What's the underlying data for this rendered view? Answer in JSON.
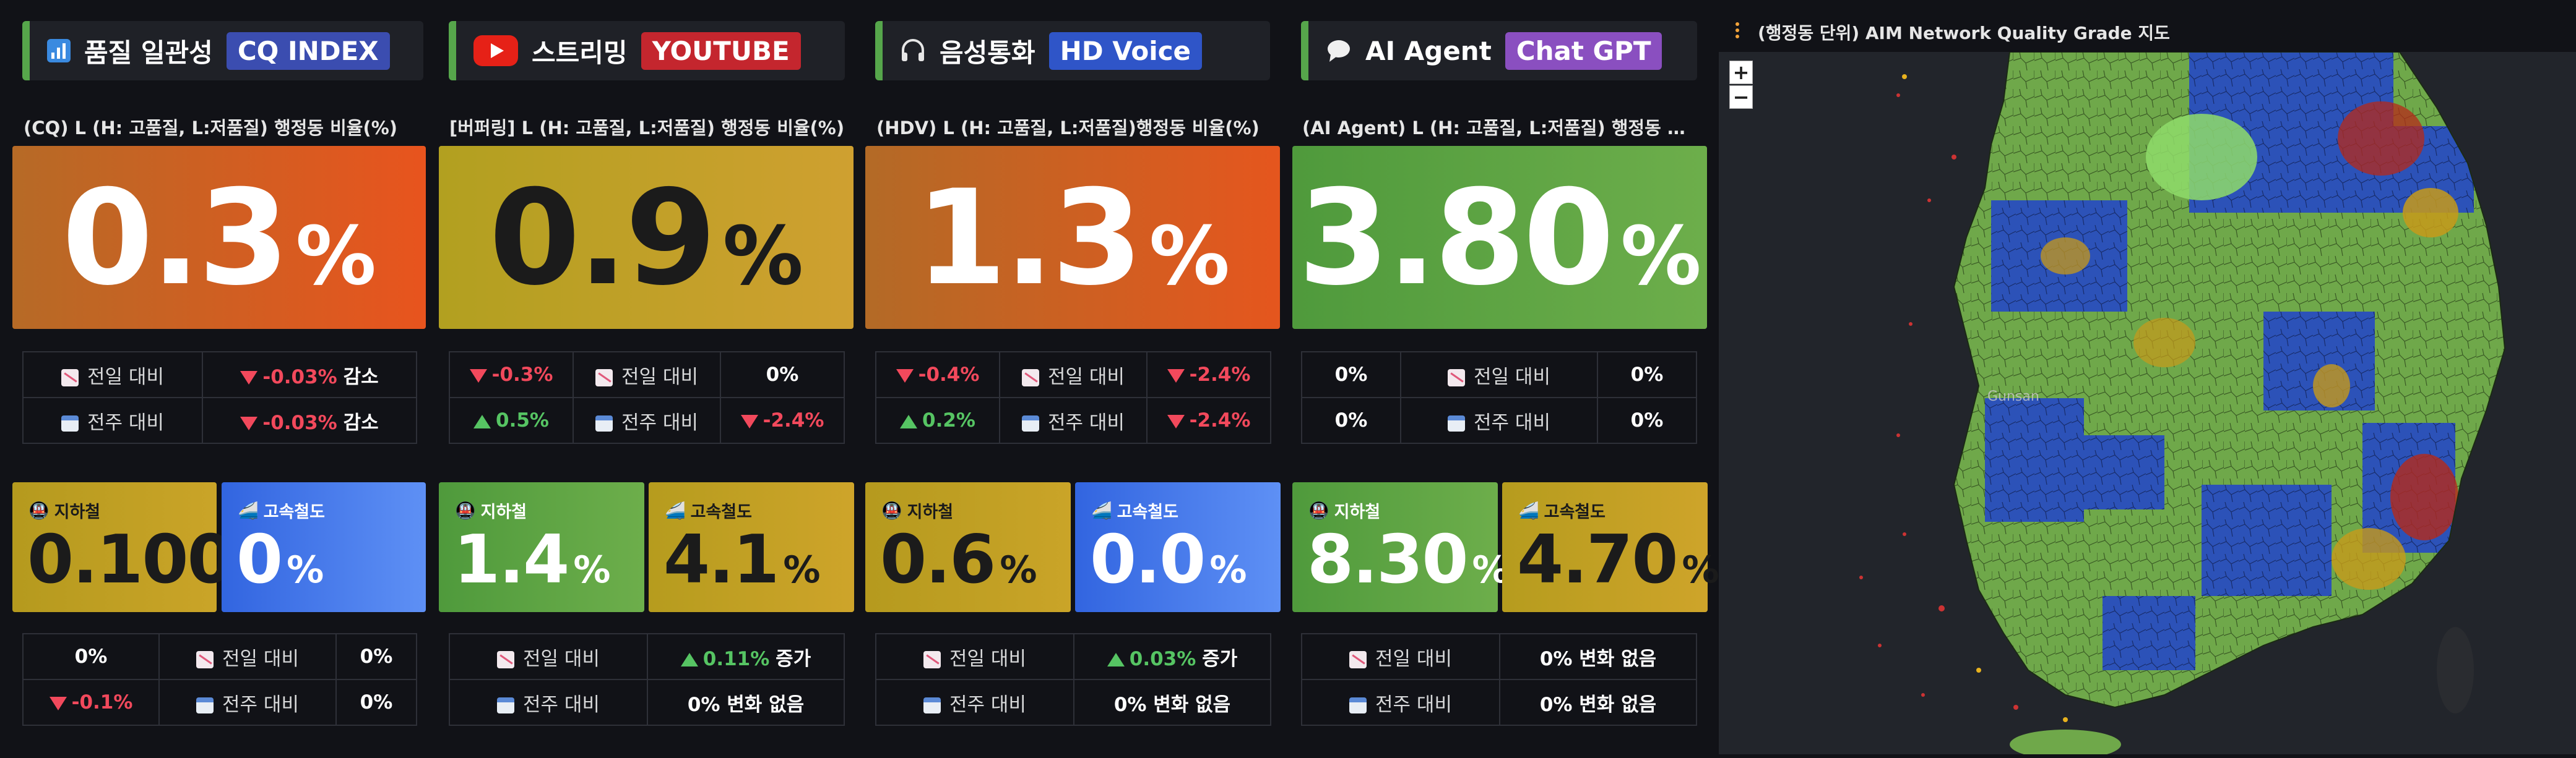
{
  "columns": [
    {
      "title": "품질 일관성",
      "badge": "CQ INDEX",
      "badge_color": "#3b4db0",
      "stripe": "#56a64b",
      "icon": "bar-chart-icon",
      "subtitle": "(CQ) L (H: 고품질, L:저품질) 행정동 비율(%)",
      "big_value": "0.3",
      "big_unit": "%",
      "big_text_color": "#ffffff",
      "big_bg": "linear-gradient(90deg,#b66a26,#e8541e)",
      "compare": [
        {
          "label": "전일 대비",
          "value": "-0.03%",
          "trend": "down",
          "suffix": "감소"
        },
        {
          "label": "전주 대비",
          "value": "-0.03%",
          "trend": "down",
          "suffix": "감소"
        }
      ],
      "subway": {
        "label": "지하철",
        "value": "0.100",
        "unit": "%",
        "bg": "linear-gradient(90deg,#b59a1e,#caa428)",
        "color": "#1b1b1b"
      },
      "ktx": {
        "label": "고속철도",
        "value": "0",
        "unit": "%",
        "bg": "linear-gradient(90deg,#3265e0,#5e90f5)",
        "color": "#ffffff"
      },
      "rail_compare": [
        {
          "left": "0%",
          "label": "전일 대비",
          "right": "0%"
        },
        {
          "left": "-0.1%",
          "left_trend": "down",
          "label": "전주 대비",
          "right": "0%"
        }
      ]
    },
    {
      "title": "스트리밍",
      "badge": "YOUTUBE",
      "badge_color": "#c4262e",
      "stripe": "#56a64b",
      "icon": "youtube-icon",
      "subtitle": "[버퍼링] L (H: 고품질, L:저품질) 행정동 비율(%)",
      "big_value": "0.9",
      "big_unit": "%",
      "big_text_color": "#1b1b1b",
      "big_bg": "linear-gradient(90deg,#b2a020,#cfa030)",
      "compare": [
        {
          "left": "-0.3%",
          "left_trend": "down",
          "label": "전일 대비",
          "right": "0%"
        },
        {
          "left": "0.5%",
          "left_trend": "up",
          "label": "전주 대비",
          "right": "-2.4%",
          "right_trend": "down"
        }
      ],
      "subway": {
        "label": "지하철",
        "value": "1.4",
        "unit": "%",
        "bg": "linear-gradient(90deg,#4f9a3c,#6dae4b)",
        "color": "#ffffff"
      },
      "ktx": {
        "label": "고속철도",
        "value": "4.1",
        "unit": "%",
        "bg": "linear-gradient(90deg,#b69c1e,#cea42a)",
        "color": "#1b1b1b"
      },
      "rail_compare": [
        {
          "label": "전일 대비",
          "value": "0.11%",
          "trend": "up",
          "suffix": "증가"
        },
        {
          "label": "전주 대비",
          "value": "0% 변화 없음"
        }
      ]
    },
    {
      "title": "음성통화",
      "badge": "HD Voice",
      "badge_color": "#2f55c8",
      "stripe": "#56a64b",
      "icon": "headphones-icon",
      "subtitle": "(HDV) L (H: 고품질, L:저품질)행정동 비율(%)",
      "big_value": "1.3",
      "big_unit": "%",
      "big_text_color": "#ffffff",
      "big_bg": "linear-gradient(90deg,#b36a26,#e5561e)",
      "compare": [
        {
          "left": "-0.4%",
          "left_trend": "down",
          "label": "전일 대비",
          "right": "-2.4%",
          "right_trend": "down"
        },
        {
          "left": "0.2%",
          "left_trend": "up",
          "label": "전주 대비",
          "right": "-2.4%",
          "right_trend": "down"
        }
      ],
      "subway": {
        "label": "지하철",
        "value": "0.6",
        "unit": "%",
        "bg": "linear-gradient(90deg,#b59a1e,#caa428)",
        "color": "#1b1b1b"
      },
      "ktx": {
        "label": "고속철도",
        "value": "0.0",
        "unit": "%",
        "bg": "linear-gradient(90deg,#3265e0,#5e90f5)",
        "color": "#ffffff"
      },
      "rail_compare": [
        {
          "label": "전일 대비",
          "value": "0.03%",
          "trend": "up",
          "suffix": "증가"
        },
        {
          "label": "전주 대비",
          "value": "0% 변화 없음"
        }
      ]
    },
    {
      "title": "AI Agent",
      "badge": "Chat GPT",
      "badge_color": "#8a4fc0",
      "stripe": "#56a64b",
      "icon": "speech-bubble-icon",
      "subtitle": "(AI Agent) L (H: 고품질, L:저품질) 행정동 비...",
      "big_value": "3.80",
      "big_unit": "%",
      "big_text_color": "#ffffff",
      "big_bg": "linear-gradient(90deg,#4f9a3c,#6dae4b)",
      "compare": [
        {
          "left": "0%",
          "label": "전일 대비",
          "right": "0%"
        },
        {
          "left": "0%",
          "label": "전주 대비",
          "right": "0%"
        }
      ],
      "subway": {
        "label": "지하철",
        "value": "8.30",
        "unit": "%",
        "bg": "linear-gradient(90deg,#4f9a3c,#6dae4b)",
        "color": "#ffffff"
      },
      "ktx": {
        "label": "고속철도",
        "value": "4.70",
        "unit": "%",
        "bg": "linear-gradient(90deg,#b69c1e,#cea42a)",
        "color": "#1b1b1b"
      },
      "rail_compare": [
        {
          "label": "전일 대비",
          "value": "0% 변화 없음"
        },
        {
          "label": "전주 대비",
          "value": "0% 변화 없음"
        }
      ]
    }
  ],
  "map": {
    "title": "(행정동 단위) AIM Network Quality Grade 지도",
    "zoom_in": "+",
    "zoom_out": "−",
    "city_label": "Gunsan"
  }
}
